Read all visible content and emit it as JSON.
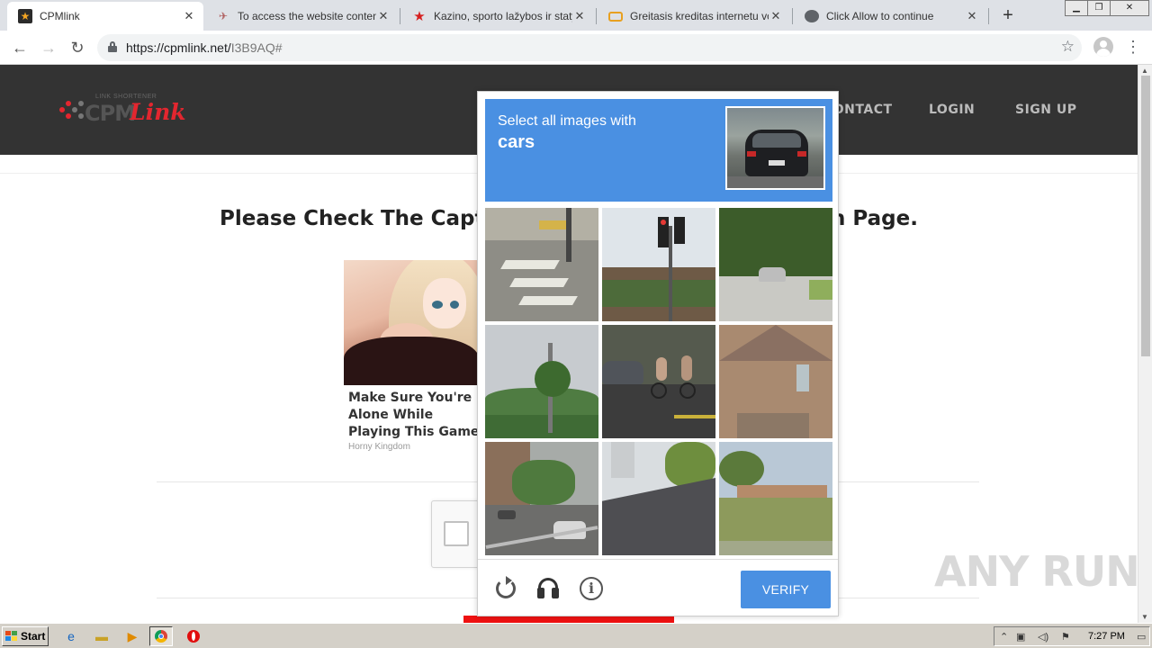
{
  "browser": {
    "tabs": [
      {
        "title": "CPMlink",
        "icon": "star-icon",
        "active": true
      },
      {
        "title": "To access the website content,",
        "icon": "bird-icon",
        "active": false
      },
      {
        "title": "Kazino, sporto lažybos ir statym",
        "icon": "red-star-icon",
        "active": false
      },
      {
        "title": "Greitasis kreditas internetu vos",
        "icon": "chat-icon",
        "active": false
      },
      {
        "title": "Click Allow to continue",
        "icon": "globe-icon",
        "active": false
      }
    ],
    "url_host": "https://cpmlink.net/",
    "url_path": "I3B9AQ#"
  },
  "site": {
    "logo_text_cpm": "CPM",
    "logo_text_link": "Link",
    "logo_tagline": "LINK SHORTENER",
    "nav": [
      "CONTACT",
      "LOGIN",
      "SIGN UP"
    ],
    "heading": "Please Check The Captcha To Continue To Destination Page.",
    "ad_headline": "Make Sure You're Alone While Playing This Game",
    "ad_source": "Horny Kingdom"
  },
  "captcha": {
    "prompt_line1": "Select all images with",
    "prompt_target": "cars",
    "verify_label": "VERIFY",
    "accent_color": "#4a90e2",
    "tiles": [
      "crosswalk",
      "traffic-light",
      "car-on-road",
      "trees-pole",
      "bicycles-car",
      "brick-house",
      "street-cars",
      "rooftop",
      "park-building"
    ]
  },
  "watermark": "ANY RUN",
  "taskbar": {
    "start_label": "Start",
    "clock": "7:27 PM"
  }
}
